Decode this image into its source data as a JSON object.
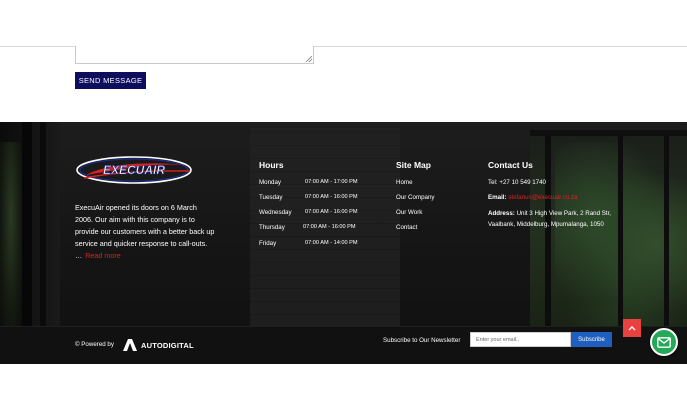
{
  "form": {
    "send_label": "SEND MESSAGE"
  },
  "brand": {
    "logo_text": "EXECUAIR",
    "accent": "#e02020",
    "navy": "#0d0d5e"
  },
  "about": {
    "text": "ExecuAir opened its doors on 6 March 2006. Our aim with this company is to provide our customers with a better back up service and quicker response to call-outs. …",
    "read_more": "Read more"
  },
  "hours": {
    "title": "Hours",
    "rows": [
      {
        "day": "Monday",
        "time": "07:00 AM - 17:00 PM"
      },
      {
        "day": "Tuesday",
        "time": "07:00 AM - 16:00 PM"
      },
      {
        "day": "Wednesday",
        "time": "07:00 AM - 16:00 PM"
      },
      {
        "day": "Thursday",
        "time": "07:00 AM - 16:00 PM"
      },
      {
        "day": "Friday",
        "time": "07:00 AM - 14:00 PM"
      }
    ]
  },
  "sitemap": {
    "title": "Site Map",
    "links": [
      "Home",
      "Our Company",
      "Our Work",
      "Contact"
    ]
  },
  "contact": {
    "title": "Contact Us",
    "tel_label": "Tel:",
    "tel": "+27 10 549 1740",
    "email_label": "Email:",
    "email": "stefanus@execuair.co.za",
    "address_label": "Address:",
    "address": "Unit 3 High View Park, 2 Rand Str, Vaalbank, Middelburg, Mpumalanga, 1050"
  },
  "bottom": {
    "powered_by": "© Powered by",
    "agency": "AUTODIGITAL",
    "newsletter_label": "Subscribe to Our Newsletter",
    "email_placeholder": "Enter your email..",
    "subscribe_label": "Subscribe",
    "subscribe_color": "#1f5fbf",
    "top_button_color": "#e94040",
    "chat_color": "#25a85a"
  },
  "icons": [
    "resize-grip-icon",
    "chevron-up-icon",
    "mail-icon",
    "autodigital-logo-icon"
  ]
}
